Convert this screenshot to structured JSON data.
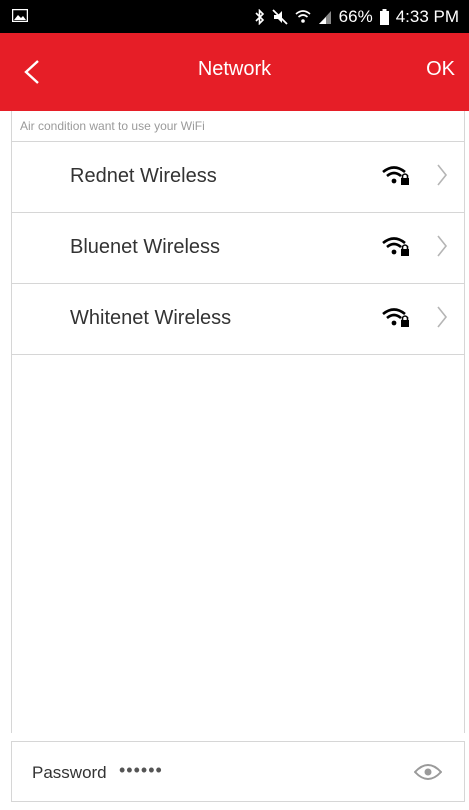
{
  "status_bar": {
    "battery_percent": "66%",
    "time": "4:33 PM",
    "icons": [
      "gallery-icon",
      "bluetooth-icon",
      "mute-icon",
      "wifi-icon",
      "signal-icon",
      "battery-icon"
    ]
  },
  "header": {
    "title": "Network",
    "ok_label": "OK",
    "background": "#e61e27"
  },
  "hint": "Air condition want to use your WiFi",
  "networks": [
    {
      "name": "Rednet Wireless",
      "secured": true
    },
    {
      "name": "Bluenet Wireless",
      "secured": true
    },
    {
      "name": "Whitenet Wireless",
      "secured": true
    }
  ],
  "password": {
    "label": "Password",
    "value": "••••••"
  }
}
